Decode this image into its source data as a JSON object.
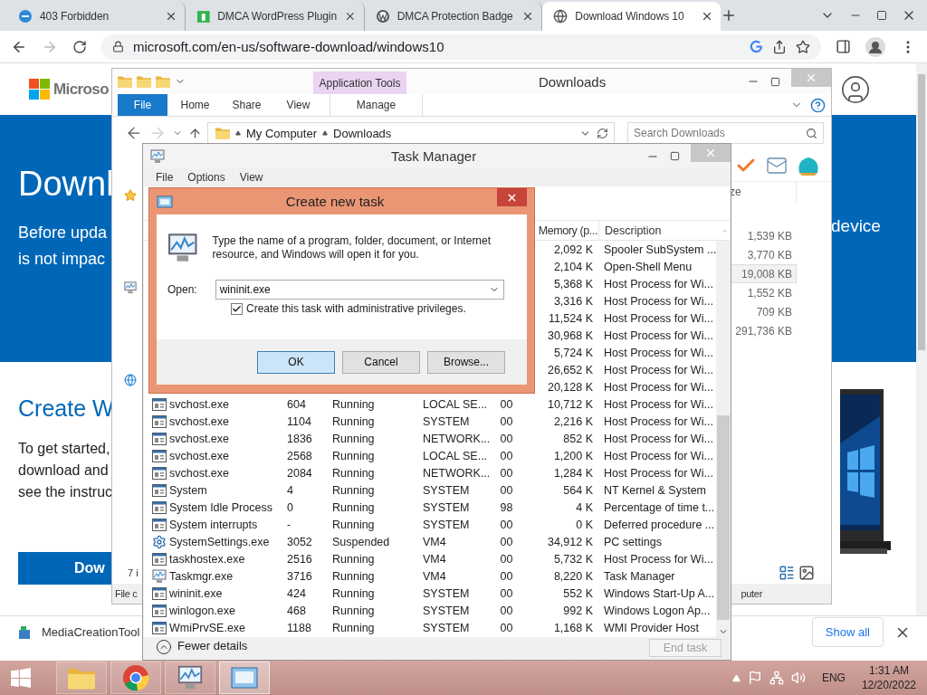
{
  "browser": {
    "tabs": [
      {
        "title": "403 Forbidden",
        "selected": false
      },
      {
        "title": "DMCA WordPress Plugin",
        "selected": false
      },
      {
        "title": "DMCA Protection Badge",
        "selected": false
      },
      {
        "title": "Download Windows 10",
        "selected": true
      }
    ],
    "url": "microsoft.com/en-us/software-download/windows10"
  },
  "webpage": {
    "logo_text": "Microso",
    "hero_title": "Downl",
    "hero_lines": [
      "Before upda",
      "is not impac"
    ],
    "hero_right_text": "device",
    "section_title": "Create W",
    "section_lines": [
      "To get started,",
      "download and",
      "see the instruc"
    ],
    "button": "Dow"
  },
  "download_bar": {
    "file_name": "MediaCreationTool",
    "show_all": "Show all"
  },
  "explorer": {
    "title": "Downloads",
    "context_tab": "Application Tools",
    "file_tab": "File",
    "ribbon_tabs": [
      "Home",
      "Share",
      "View"
    ],
    "context_ribbon_tab": "Manage",
    "path": [
      "My Computer",
      "Downloads"
    ],
    "search_placeholder": "Search Downloads",
    "size_column": "ze",
    "sizes": [
      {
        "value": "1,539 KB",
        "selected": false
      },
      {
        "value": "3,770 KB",
        "selected": false
      },
      {
        "value": "19,008 KB",
        "selected": true
      },
      {
        "value": "1,552 KB",
        "selected": false
      },
      {
        "value": "709 KB",
        "selected": false
      },
      {
        "value": "291,736 KB",
        "selected": false
      }
    ],
    "status": "7 i",
    "footer_left": "File c",
    "footer_right": "puter"
  },
  "task_manager": {
    "title": "Task Manager",
    "menu": [
      "File",
      "Options",
      "View"
    ],
    "columns": [
      "Memory (p...",
      "Description"
    ],
    "rows": [
      {
        "memory": "2,092 K",
        "description": "Spooler SubSystem ..."
      },
      {
        "memory": "2,104 K",
        "description": "Open-Shell Menu"
      },
      {
        "memory": "5,368 K",
        "description": "Host Process for Wi..."
      },
      {
        "memory": "3,316 K",
        "description": "Host Process for Wi..."
      },
      {
        "memory": "11,524 K",
        "description": "Host Process for Wi..."
      },
      {
        "memory": "30,968 K",
        "description": "Host Process for Wi..."
      },
      {
        "memory": "5,724 K",
        "description": "Host Process for Wi..."
      },
      {
        "memory": "26,652 K",
        "description": "Host Process for Wi..."
      },
      {
        "memory": "20,128 K",
        "description": "Host Process for Wi..."
      },
      {
        "kind": "service",
        "name": "svchost.exe",
        "pid": "604",
        "status": "Running",
        "user": "LOCAL SE...",
        "cpu": "00",
        "memory": "10,712 K",
        "description": "Host Process for Wi..."
      },
      {
        "kind": "service",
        "name": "svchost.exe",
        "pid": "1104",
        "status": "Running",
        "user": "SYSTEM",
        "cpu": "00",
        "memory": "2,216 K",
        "description": "Host Process for Wi..."
      },
      {
        "kind": "service",
        "name": "svchost.exe",
        "pid": "1836",
        "status": "Running",
        "user": "NETWORK...",
        "cpu": "00",
        "memory": "852 K",
        "description": "Host Process for Wi..."
      },
      {
        "kind": "service",
        "name": "svchost.exe",
        "pid": "2568",
        "status": "Running",
        "user": "LOCAL SE...",
        "cpu": "00",
        "memory": "1,200 K",
        "description": "Host Process for Wi..."
      },
      {
        "kind": "service",
        "name": "svchost.exe",
        "pid": "2084",
        "status": "Running",
        "user": "NETWORK...",
        "cpu": "00",
        "memory": "1,284 K",
        "description": "Host Process for Wi..."
      },
      {
        "kind": "service",
        "name": "System",
        "pid": "4",
        "status": "Running",
        "user": "SYSTEM",
        "cpu": "00",
        "memory": "564 K",
        "description": "NT Kernel & System"
      },
      {
        "kind": "service",
        "name": "System Idle Process",
        "pid": "0",
        "status": "Running",
        "user": "SYSTEM",
        "cpu": "98",
        "memory": "4 K",
        "description": "Percentage of time t..."
      },
      {
        "kind": "service",
        "name": "System interrupts",
        "pid": "-",
        "status": "Running",
        "user": "SYSTEM",
        "cpu": "00",
        "memory": "0 K",
        "description": "Deferred procedure ..."
      },
      {
        "kind": "settings",
        "name": "SystemSettings.exe",
        "pid": "3052",
        "status": "Suspended",
        "user": "VM4",
        "cpu": "00",
        "memory": "34,912 K",
        "description": "PC settings"
      },
      {
        "kind": "service",
        "name": "taskhostex.exe",
        "pid": "2516",
        "status": "Running",
        "user": "VM4",
        "cpu": "00",
        "memory": "5,732 K",
        "description": "Host Process for Wi..."
      },
      {
        "kind": "monitor",
        "name": "Taskmgr.exe",
        "pid": "3716",
        "status": "Running",
        "user": "VM4",
        "cpu": "00",
        "memory": "8,220 K",
        "description": "Task Manager"
      },
      {
        "kind": "service",
        "name": "wininit.exe",
        "pid": "424",
        "status": "Running",
        "user": "SYSTEM",
        "cpu": "00",
        "memory": "552 K",
        "description": "Windows Start-Up A..."
      },
      {
        "kind": "service",
        "name": "winlogon.exe",
        "pid": "468",
        "status": "Running",
        "user": "SYSTEM",
        "cpu": "00",
        "memory": "992 K",
        "description": "Windows Logon Ap..."
      },
      {
        "kind": "service",
        "name": "WmiPrvSE.exe",
        "pid": "1188",
        "status": "Running",
        "user": "SYSTEM",
        "cpu": "00",
        "memory": "1,168 K",
        "description": "WMI Provider Host"
      }
    ],
    "fewer_details": "Fewer details",
    "end_task": {
      "label": "End task",
      "disabled": true
    }
  },
  "dialog": {
    "title": "Create new task",
    "message": "Type the name of a program, folder, document, or Internet resource, and Windows will open it for you.",
    "open_label": "Open:",
    "open_value": "wininit.exe",
    "admin": {
      "label": "Create this task with administrative privileges.",
      "checked": true
    },
    "buttons": [
      {
        "label": "OK",
        "default": true
      },
      {
        "label": "Cancel",
        "default": false
      },
      {
        "label": "Browse...",
        "default": false
      }
    ]
  },
  "taskbar": {
    "apps": [
      {
        "active": false
      },
      {
        "active": false
      },
      {
        "active": false
      },
      {
        "active": true
      }
    ],
    "language": "ENG",
    "time": "1:31 AM",
    "date": "12/20/2022"
  }
}
